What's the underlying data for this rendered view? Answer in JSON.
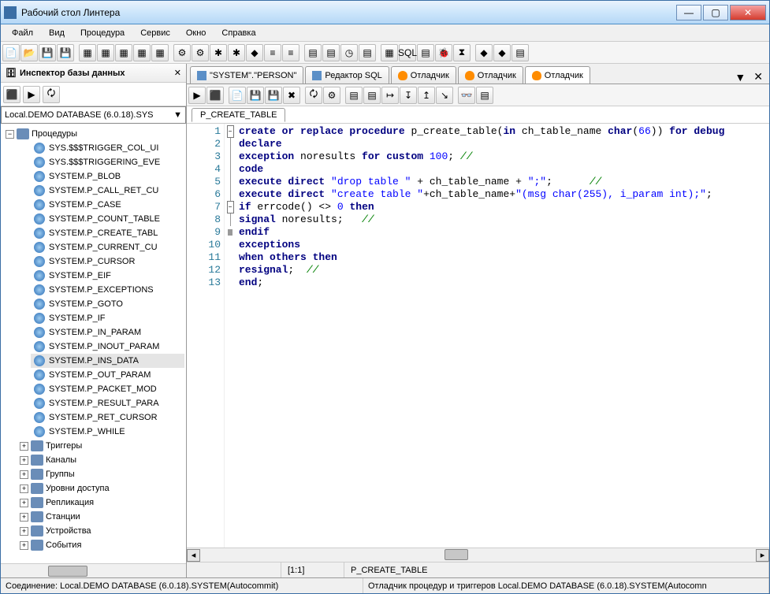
{
  "window": {
    "title": "Рабочий стол Линтера"
  },
  "menu": [
    "Файл",
    "Вид",
    "Процедура",
    "Сервис",
    "Окно",
    "Справка"
  ],
  "inspector": {
    "title": "Инспектор базы данных",
    "db": "Local.DEMO DATABASE (6.0.18).SYS",
    "root": "Процедуры",
    "procs": [
      "SYS.$$$TRIGGER_COL_UI",
      "SYS.$$$TRIGGERING_EVE",
      "SYSTEM.P_BLOB",
      "SYSTEM.P_CALL_RET_CU",
      "SYSTEM.P_CASE",
      "SYSTEM.P_COUNT_TABLE",
      "SYSTEM.P_CREATE_TABL",
      "SYSTEM.P_CURRENT_CU",
      "SYSTEM.P_CURSOR",
      "SYSTEM.P_EIF",
      "SYSTEM.P_EXCEPTIONS",
      "SYSTEM.P_GOTO",
      "SYSTEM.P_IF",
      "SYSTEM.P_IN_PARAM",
      "SYSTEM.P_INOUT_PARAM",
      "SYSTEM.P_INS_DATA",
      "SYSTEM.P_OUT_PARAM",
      "SYSTEM.P_PACKET_MOD",
      "SYSTEM.P_RESULT_PARA",
      "SYSTEM.P_RET_CURSOR",
      "SYSTEM.P_WHILE"
    ],
    "folders": [
      "Триггеры",
      "Каналы",
      "Группы",
      "Уровни доступа",
      "Репликация",
      "Станции",
      "Устройства",
      "События"
    ]
  },
  "tabs": [
    {
      "icon": "table",
      "label": "\"SYSTEM\".\"PERSON\""
    },
    {
      "icon": "sql",
      "label": "Редактор SQL"
    },
    {
      "icon": "bug",
      "label": "Отладчик"
    },
    {
      "icon": "bug",
      "label": "Отладчик"
    },
    {
      "icon": "bug",
      "label": "Отладчик",
      "active": true
    }
  ],
  "proc_tab": "P_CREATE_TABLE",
  "code_lines": [
    {
      "n": 1,
      "fold": "open",
      "tokens": [
        [
          "kw",
          "create or replace procedure"
        ],
        [
          "ident",
          " p_create_table"
        ],
        [
          "ident",
          "("
        ],
        [
          "kw",
          "in"
        ],
        [
          "ident",
          " ch_table_name "
        ],
        [
          "kw",
          "char"
        ],
        [
          "ident",
          "("
        ],
        [
          "num",
          "66"
        ],
        [
          "ident",
          ")) "
        ],
        [
          "kw",
          "for debug"
        ]
      ]
    },
    {
      "n": 2,
      "fold": "line",
      "tokens": [
        [
          "kw",
          "declare"
        ]
      ]
    },
    {
      "n": 3,
      "fold": "line",
      "tokens": [
        [
          "kw",
          "exception"
        ],
        [
          "ident",
          " noresults "
        ],
        [
          "kw",
          "for custom"
        ],
        [
          "ident",
          " "
        ],
        [
          "num",
          "100"
        ],
        [
          "ident",
          "; "
        ],
        [
          "cmt",
          "//"
        ]
      ]
    },
    {
      "n": 4,
      "fold": "line",
      "tokens": [
        [
          "kw",
          "code"
        ]
      ]
    },
    {
      "n": 5,
      "fold": "line",
      "tokens": [
        [
          "kw",
          "execute direct"
        ],
        [
          "ident",
          " "
        ],
        [
          "str",
          "\"drop table \""
        ],
        [
          "ident",
          " + ch_table_name + "
        ],
        [
          "str",
          "\";\""
        ],
        [
          "ident",
          ";      "
        ],
        [
          "cmt",
          "//"
        ]
      ]
    },
    {
      "n": 6,
      "fold": "line",
      "tokens": [
        [
          "kw",
          "execute direct"
        ],
        [
          "ident",
          " "
        ],
        [
          "str",
          "\"create table \""
        ],
        [
          "ident",
          "+ch_table_name+"
        ],
        [
          "str",
          "\"(msg char(255), i_param int);\""
        ],
        [
          "ident",
          ";"
        ]
      ]
    },
    {
      "n": 7,
      "fold": "open",
      "tokens": [
        [
          "kw",
          "if"
        ],
        [
          "ident",
          " errcode"
        ],
        [
          "ident",
          "() <> "
        ],
        [
          "num",
          "0"
        ],
        [
          "ident",
          " "
        ],
        [
          "kw",
          "then"
        ]
      ]
    },
    {
      "n": 8,
      "fold": "line",
      "tokens": [
        [
          "kw",
          "signal"
        ],
        [
          "ident",
          " noresults;   "
        ],
        [
          "cmt",
          "//"
        ]
      ]
    },
    {
      "n": 9,
      "fold": "end",
      "tokens": [
        [
          "kw",
          "endif"
        ]
      ]
    },
    {
      "n": 10,
      "fold": "",
      "tokens": [
        [
          "kw",
          "exceptions"
        ]
      ]
    },
    {
      "n": 11,
      "fold": "",
      "tokens": [
        [
          "kw",
          "when others then"
        ]
      ]
    },
    {
      "n": 12,
      "fold": "",
      "tokens": [
        [
          "kw",
          "resignal"
        ],
        [
          "ident",
          ";  "
        ],
        [
          "cmt",
          "//"
        ]
      ]
    },
    {
      "n": 13,
      "fold": "",
      "tokens": [
        [
          "kw",
          "end"
        ],
        [
          "ident",
          ";"
        ]
      ]
    }
  ],
  "cursor": "[1:1]",
  "current_proc": "P_CREATE_TABLE",
  "status_left": "Соединение: Local.DEMO DATABASE (6.0.18).SYSTEM(Autocommit)",
  "status_right": "Отладчик процедур и триггеров Local.DEMO DATABASE (6.0.18).SYSTEM(Autocomn"
}
